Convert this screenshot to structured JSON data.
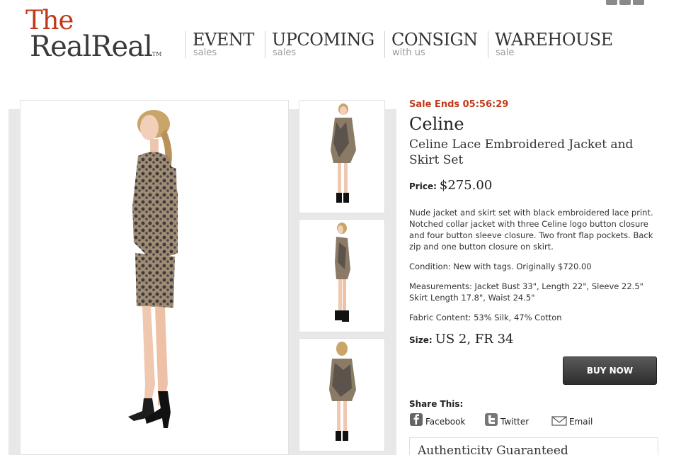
{
  "logo": {
    "the": "The",
    "realreal": "RealReal",
    "tm": "TM"
  },
  "nav": [
    {
      "main": "EVENT",
      "sub": "sales"
    },
    {
      "main": "UPCOMING",
      "sub": "sales"
    },
    {
      "main": "CONSIGN",
      "sub": "with us"
    },
    {
      "main": "WAREHOUSE",
      "sub": "sale"
    }
  ],
  "product": {
    "sale_ends": "Sale Ends 05:56:29",
    "brand": "Celine",
    "title": "Celine Lace Embroidered Jacket and Skirt Set",
    "price_label": "Price:",
    "price": "$275.00",
    "description": "Nude jacket and skirt set with black embroidered lace print. Notched collar jacket with three Celine logo button closure and four button sleeve closure. Two front flap pockets. Back zip and one button closure on skirt.",
    "condition": "Condition: New with tags. Originally $720.00",
    "measurements": "Measurements: Jacket Bust 33\", Length 22\", Sleeve 22.5\" Skirt Length 17.8\", Waist 24.5\"",
    "fabric": "Fabric Content: 53% Silk, 47% Cotton",
    "size_label": "Size:",
    "size": "US 2, FR 34",
    "buy_label": "BUY NOW"
  },
  "share": {
    "title": "Share This:",
    "facebook": "Facebook",
    "twitter": "Twitter",
    "email": "Email"
  },
  "authenticity": "Authenticity Guaranteed",
  "colors": {
    "accent": "#c0391b",
    "button": "#3a3a3a",
    "gallery_bg": "#e8e8e8"
  }
}
